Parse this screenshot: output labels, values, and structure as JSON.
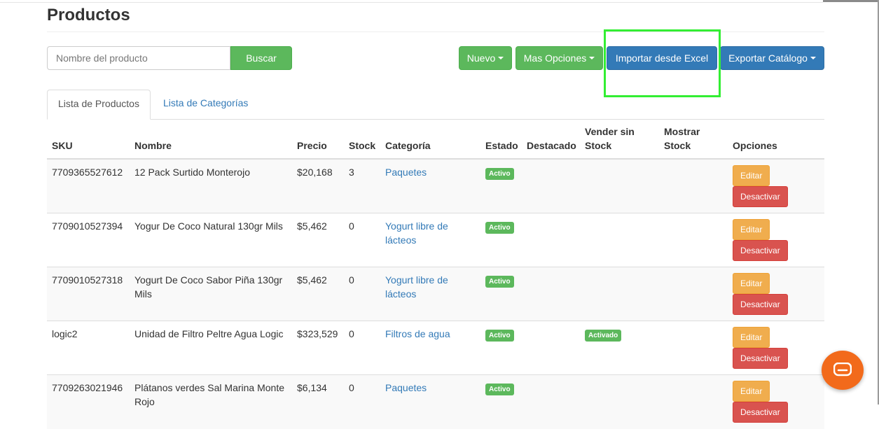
{
  "page": {
    "title": "Productos"
  },
  "search": {
    "placeholder": "Nombre del producto",
    "button_label": "Buscar"
  },
  "toolbar": {
    "nuevo_label": "Nuevo",
    "mas_opciones_label": "Mas Opciones",
    "importar_label": "Importar desde Excel",
    "exportar_label": "Exportar Catálogo"
  },
  "tabs": [
    {
      "label": "Lista de Productos",
      "active": true
    },
    {
      "label": "Lista de Categorías",
      "active": false
    }
  ],
  "table": {
    "headers": [
      "SKU",
      "Nombre",
      "Precio",
      "Stock",
      "Categoría",
      "Estado",
      "Destacado",
      "Vender sin Stock",
      "Mostrar Stock",
      "Opciones"
    ],
    "rows": [
      {
        "sku": "7709365527612",
        "nombre": "12 Pack Surtido Monterojo",
        "precio": "$20,168",
        "stock": "3",
        "categoria": "Paquetes",
        "estado": "Activo",
        "destacado": "",
        "vender_sin_stock": "",
        "mostrar_stock": "",
        "editar": "Editar",
        "desactivar": "Desactivar"
      },
      {
        "sku": "7709010527394",
        "nombre": "Yogur De Coco Natural 130gr Mils",
        "precio": "$5,462",
        "stock": "0",
        "categoria": "Yogurt libre de lácteos",
        "estado": "Activo",
        "destacado": "",
        "vender_sin_stock": "",
        "mostrar_stock": "",
        "editar": "Editar",
        "desactivar": "Desactivar"
      },
      {
        "sku": "7709010527318",
        "nombre": "Yogurt De Coco Sabor Piña 130gr Mils",
        "precio": "$5,462",
        "stock": "0",
        "categoria": "Yogurt libre de lácteos",
        "estado": "Activo",
        "destacado": "",
        "vender_sin_stock": "",
        "mostrar_stock": "",
        "editar": "Editar",
        "desactivar": "Desactivar"
      },
      {
        "sku": "logic2",
        "nombre": "Unidad de Filtro Peltre Agua Logic",
        "precio": "$323,529",
        "stock": "0",
        "categoria": "Filtros de agua",
        "estado": "Activo",
        "destacado": "",
        "vender_sin_stock": "Activado",
        "mostrar_stock": "",
        "editar": "Editar",
        "desactivar": "Desactivar"
      },
      {
        "sku": "7709263021946",
        "nombre": "Plátanos verdes Sal Marina Monte Rojo",
        "precio": "$6,134",
        "stock": "0",
        "categoria": "Paquetes",
        "estado": "Activo",
        "destacado": "",
        "vender_sin_stock": "",
        "mostrar_stock": "",
        "editar": "Editar",
        "desactivar": "Desactivar"
      }
    ]
  },
  "colors": {
    "success": "#5cb85c",
    "primary": "#337ab7",
    "warning": "#f0ad4e",
    "danger": "#d9534f",
    "highlight": "#33ee33",
    "chat": "#f26a1b"
  },
  "chat": {
    "icon": "chat-icon"
  }
}
